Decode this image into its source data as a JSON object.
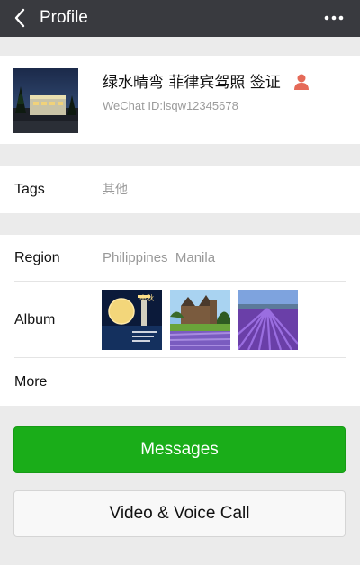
{
  "header": {
    "title": "Profile",
    "back_icon": "chevron-left-icon",
    "more_icon": "more-dots-icon",
    "background": "#393a3f"
  },
  "profile": {
    "nickname": "绿水晴弯 菲律宾驾照 签证",
    "wechat_id": "WeChat ID:lsqw12345678",
    "gender_icon": "person-icon"
  },
  "tags": {
    "label": "Tags",
    "value": "其他"
  },
  "region": {
    "label": "Region",
    "value": "Philippines  Manila"
  },
  "album": {
    "label": "Album",
    "thumbnails": [
      {
        "icon": "moon-poster-thumbnail",
        "caption": "中秋"
      },
      {
        "icon": "castle-lavender-thumbnail"
      },
      {
        "icon": "lavender-field-thumbnail"
      }
    ]
  },
  "more": {
    "label": "More"
  },
  "buttons": {
    "messages": "Messages",
    "call": "Video & Voice Call"
  },
  "colors": {
    "accent": "#1aad19",
    "page_background": "#ebebeb"
  }
}
